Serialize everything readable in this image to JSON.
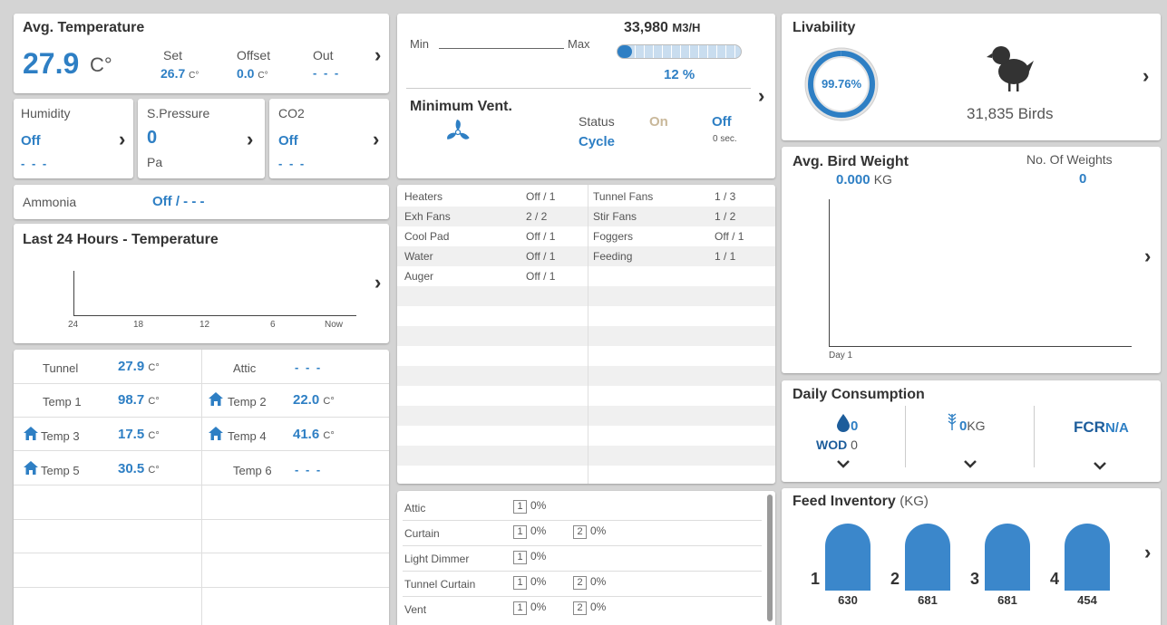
{
  "avg_temp": {
    "title": "Avg. Temperature",
    "value": "27.9",
    "unit": "C°",
    "set_label": "Set",
    "set_value": "26.7",
    "set_unit": "C°",
    "offset_label": "Offset",
    "offset_value": "0.0",
    "offset_unit": "C°",
    "out_label": "Out",
    "out_value": "- - -"
  },
  "humidity": {
    "label": "Humidity",
    "value": "Off",
    "sub": "- - -"
  },
  "spressure": {
    "label": "S.Pressure",
    "value": "0",
    "unit": "Pa"
  },
  "co2": {
    "label": "CO2",
    "value": "Off",
    "sub": "- - -"
  },
  "ammonia": {
    "label": "Ammonia",
    "value": "Off / - - -"
  },
  "last24": {
    "title": "Last 24 Hours - Temperature",
    "ticks": [
      "24",
      "18",
      "12",
      "6",
      "Now"
    ]
  },
  "temps": {
    "tunnel_label": "Tunnel",
    "tunnel_value": "27.9",
    "tunnel_unit": "C°",
    "attic_label": "Attic",
    "attic_value": "- - -",
    "temp1_label": "Temp 1",
    "temp1_value": "98.7",
    "temp1_unit": "C°",
    "temp2_label": "Temp 2",
    "temp2_value": "22.0",
    "temp2_unit": "C°",
    "temp3_label": "Temp 3",
    "temp3_value": "17.5",
    "temp3_unit": "C°",
    "temp4_label": "Temp 4",
    "temp4_value": "41.6",
    "temp4_unit": "C°",
    "temp5_label": "Temp 5",
    "temp5_value": "30.5",
    "temp5_unit": "C°",
    "temp6_label": "Temp 6",
    "temp6_value": "- - -"
  },
  "vent": {
    "min_label": "Min",
    "max_label": "Max",
    "airflow": "33,980",
    "airflow_unit": "M3/H",
    "percent": "12 %",
    "fill_fraction": 0.12,
    "title": "Minimum Vent.",
    "status_label": "Status",
    "status_on": "On",
    "status_off": "Off",
    "mode": "Cycle",
    "sec": "0 sec."
  },
  "devices": {
    "left": [
      {
        "name": "Heaters",
        "val": "Off / 1"
      },
      {
        "name": "Exh Fans",
        "val": "2 / 2"
      },
      {
        "name": "Cool Pad",
        "val": "Off / 1"
      },
      {
        "name": "Water",
        "val": "Off / 1"
      },
      {
        "name": "Auger",
        "val": "Off / 1"
      }
    ],
    "right": [
      {
        "name": "Tunnel Fans",
        "val": "1 / 3"
      },
      {
        "name": "Stir Fans",
        "val": "1 / 2"
      },
      {
        "name": "Foggers",
        "val": "Off / 1"
      },
      {
        "name": "Feeding",
        "val": "1 / 1"
      }
    ]
  },
  "inlets": [
    {
      "name": "Attic",
      "items": [
        {
          "num": "1",
          "pct": "0%"
        }
      ]
    },
    {
      "name": "Curtain",
      "items": [
        {
          "num": "1",
          "pct": "0%"
        },
        {
          "num": "2",
          "pct": "0%"
        }
      ]
    },
    {
      "name": "Light Dimmer",
      "items": [
        {
          "num": "1",
          "pct": "0%"
        }
      ]
    },
    {
      "name": "Tunnel Curtain",
      "items": [
        {
          "num": "1",
          "pct": "0%"
        },
        {
          "num": "2",
          "pct": "0%"
        }
      ]
    },
    {
      "name": "Vent",
      "items": [
        {
          "num": "1",
          "pct": "0%"
        },
        {
          "num": "2",
          "pct": "0%"
        }
      ]
    }
  ],
  "livability": {
    "title": "Livability",
    "percent": "99.76%",
    "birds": "31,835 Birds",
    "fraction": 0.9976
  },
  "bird_weight": {
    "title": "Avg. Bird Weight",
    "value": "0.000",
    "unit": "KG",
    "weights_label": "No. Of Weights",
    "weights_value": "0",
    "x_label": "Day 1"
  },
  "consumption": {
    "title": "Daily Consumption",
    "water_value": "0",
    "wod_label": "WOD",
    "wod_value": "0",
    "feed_value": "0",
    "feed_unit": "KG",
    "fcr_label": "FCR",
    "fcr_value": "N/A"
  },
  "feed_inventory": {
    "title": "Feed Inventory",
    "unit": "(KG)",
    "silos": [
      {
        "num": "1",
        "value": "630"
      },
      {
        "num": "2",
        "value": "681"
      },
      {
        "num": "3",
        "value": "681"
      },
      {
        "num": "4",
        "value": "454"
      }
    ]
  },
  "colors": {
    "accent": "#2e7fc4",
    "background": "#d4d4d4",
    "silo": "#3b87cb"
  }
}
